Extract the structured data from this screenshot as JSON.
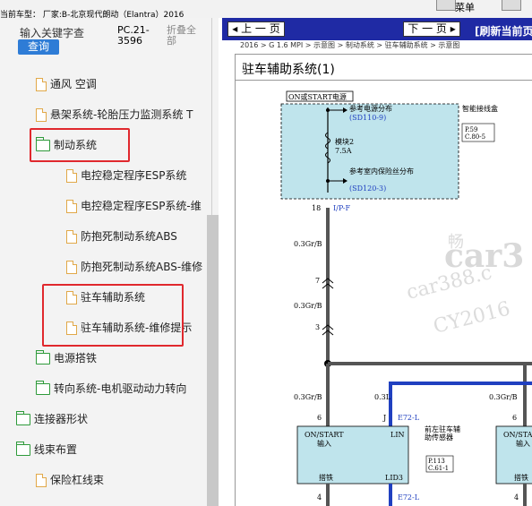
{
  "top": {
    "car_label": "当前车型： 厂家:B-北京现代朗动（Elantra）2016",
    "menu_label": "菜单"
  },
  "left_panel": {
    "search_placeholder": "输入关键字查",
    "search_button": "查询",
    "pc_code": "PC.21-3596",
    "collapse_all": "折叠全部",
    "items": [
      {
        "label": "通风 空调",
        "icon": "file-icon"
      },
      {
        "label": "悬架系统-轮胎压力监测系统 T",
        "icon": "file-icon"
      },
      {
        "label": "制动系统",
        "icon": "folder-open-icon"
      },
      {
        "label": "电控稳定程序ESP系统",
        "icon": "file-icon"
      },
      {
        "label": "电控稳定程序ESP系统-维",
        "icon": "file-icon"
      },
      {
        "label": "防抱死制动系统ABS",
        "icon": "file-icon"
      },
      {
        "label": "防抱死制动系统ABS-维修",
        "icon": "file-icon"
      },
      {
        "label": "驻车辅助系统",
        "icon": "file-icon"
      },
      {
        "label": "驻车辅助系统-维修提示",
        "icon": "file-icon"
      },
      {
        "label": "电源搭铁",
        "icon": "folder-icon"
      },
      {
        "label": "转向系统-电机驱动动力转向",
        "icon": "folder-icon"
      },
      {
        "label": "连接器形状",
        "icon": "folder-icon"
      },
      {
        "label": "线束布置",
        "icon": "folder-open-icon"
      },
      {
        "label": "保险杠线束",
        "icon": "file-icon"
      }
    ]
  },
  "right_panel": {
    "prev_label": "上 一 页",
    "next_label": "下 一 页",
    "refresh_label": "[刷新当前页",
    "breadcrumb": "2016 > G 1.6 MPI > 示意图 > 制动系统 > 驻车辅助系统 > 示意图",
    "title": "驻车辅助系统(1)",
    "diagram": {
      "power_label": "ON或START电源",
      "ref_power_dist": "参考电源分布",
      "ref_power_dist_code": "(SD110-9)",
      "smart_junction": "智能接线盒",
      "smart_junction_ref1": "P.59",
      "smart_junction_ref2": "C.80-5",
      "fuse_name": "模块2",
      "fuse_rating": "7.5A",
      "ref_indoor_fuse": "参考室内保险丝分布",
      "ref_indoor_fuse_code": "(SD120-3)",
      "pin18": "18",
      "connector_ipf": "I/P-F",
      "wire1": "0.3Gr/B",
      "pin7": "7",
      "wire2": "0.3Gr/B",
      "pin3": "3",
      "wire3": "0.3Gr/B",
      "wire_lin": "0.3L",
      "wire4": "0.3Gr/B",
      "pin6": "6",
      "pin_j": "J",
      "connector_e72l": "E72-L",
      "pin6b": "6",
      "module_on_start": "ON/START",
      "module_input": "输入",
      "module_lin": "LIN",
      "module_gnd": "搭铁",
      "module_lid3": "LID3",
      "sensor_name": "前左驻车辅助传感器",
      "sensor_ref1": "P.113",
      "sensor_ref2": "C.61-1",
      "module2_on_start": "ON/STAR",
      "module2_input": "输入",
      "module2_gnd": "搭铁",
      "pin4": "4",
      "connector_e72l_b": "E72-L",
      "pin4b": "4",
      "watermark1": "car3",
      "watermark2": "car388.c",
      "watermark3": "CY2016",
      "watermark4": "畅"
    }
  },
  "colors": {
    "nav_blue": "#1f2aa4",
    "highlight_red": "#e0282d",
    "module_fill": "#bfe4ec",
    "lin_wire": "#2040c0",
    "folder_green": "#2e9a3a",
    "file_orange": "#e1a848"
  }
}
